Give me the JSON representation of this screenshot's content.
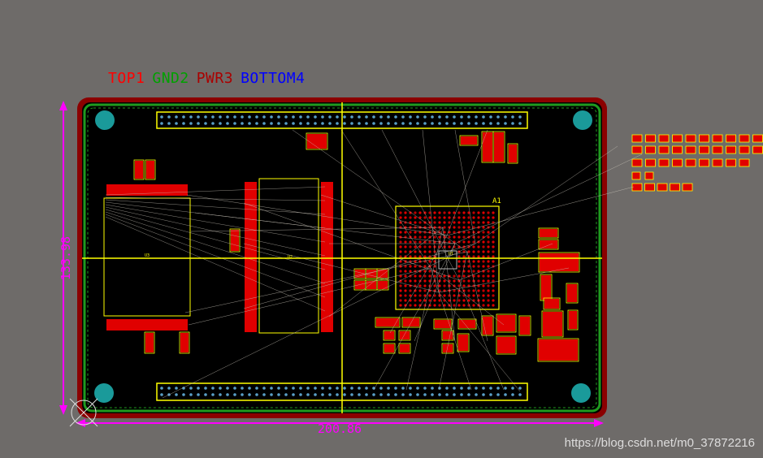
{
  "colors": {
    "background": "#6e6b69",
    "board": "#000000",
    "outline_red": "#8b0000",
    "outline_green": "#1f9a1f",
    "silkscreen": "#ffff00",
    "pad_red": "#e00000",
    "ratsnest": "#c8c3b8",
    "dimension": "#ff00ff",
    "mounting_hole": "#1a9a9a",
    "via": "#5aa0c8"
  },
  "layers": [
    {
      "name": "TOP1",
      "color": "#ff0000"
    },
    {
      "name": "GND2",
      "color": "#00a000"
    },
    {
      "name": "PWR3",
      "color": "#aa0000"
    },
    {
      "name": "BOTTOM4",
      "color": "#0000ff"
    }
  ],
  "dimensions": {
    "height_label": "133.98",
    "width_label": "200.86"
  },
  "watermark": "https://blog.csdn.net/m0_37872216",
  "components": {
    "fpga_label": "U1",
    "left_chip_label": "U3",
    "center_chip_label": "U2",
    "pin1_marker": "A1"
  }
}
